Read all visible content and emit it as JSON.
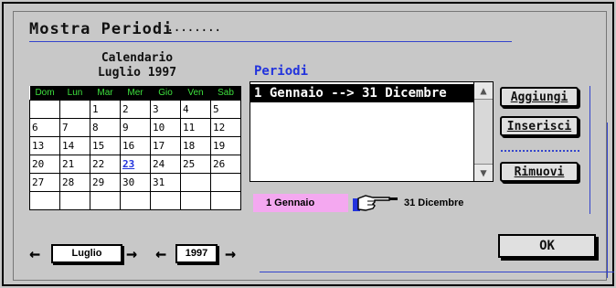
{
  "dialog": {
    "title": "Mostra Periodi",
    "title_suffix": "........"
  },
  "calendar": {
    "heading": "Calendario",
    "month_year": "Luglio 1997",
    "weekdays": [
      "Dom",
      "Lun",
      "Mar",
      "Mer",
      "Gio",
      "Ven",
      "Sab"
    ],
    "rows": [
      [
        "",
        "",
        "1",
        "2",
        "3",
        "4",
        "5"
      ],
      [
        "6",
        "7",
        "8",
        "9",
        "10",
        "11",
        "12"
      ],
      [
        "13",
        "14",
        "15",
        "16",
        "17",
        "18",
        "19"
      ],
      [
        "20",
        "21",
        "22",
        "23",
        "24",
        "25",
        "26"
      ],
      [
        "27",
        "28",
        "29",
        "30",
        "31",
        "",
        ""
      ],
      [
        "",
        "",
        "",
        "",
        "",
        "",
        ""
      ]
    ],
    "highlighted_day": "23",
    "month_selector": "Luglio",
    "year_selector": "1997"
  },
  "periods": {
    "label": "Periodi",
    "items": [
      "1 Gennaio --> 31 Dicembre"
    ],
    "selected_index": 0,
    "start_label": "1 Gennaio",
    "end_label": "31 Dicembre"
  },
  "buttons": {
    "add": "Aggiungi",
    "insert": "Inserisci",
    "remove": "Rimuovi",
    "ok": "OK"
  },
  "colors": {
    "accent_blue": "#3344cc",
    "weekday_text": "#3ee03e",
    "start_highlight": "#f4a8f0"
  }
}
